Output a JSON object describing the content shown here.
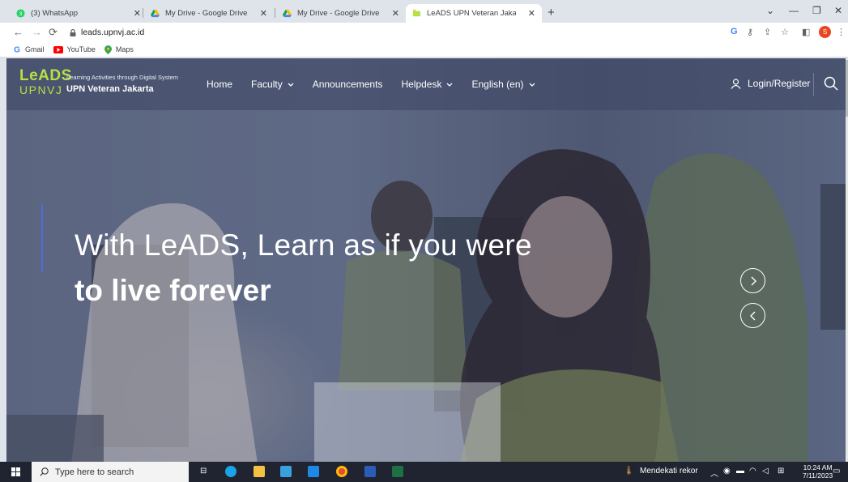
{
  "browser": {
    "tabs": [
      {
        "title": "(3) WhatsApp",
        "active": false
      },
      {
        "title": "My Drive - Google Drive",
        "active": false
      },
      {
        "title": "My Drive - Google Drive",
        "active": false
      },
      {
        "title": "LeADS UPN Veteran Jakarta",
        "active": true
      }
    ],
    "url": "leads.upnvj.ac.id",
    "whatsapp_badge": "3",
    "profile_initial": "S",
    "bookmarks": [
      {
        "label": "Gmail",
        "icon": "google-icon"
      },
      {
        "label": "YouTube",
        "icon": "youtube-icon"
      },
      {
        "label": "Maps",
        "icon": "maps-pin-icon"
      }
    ]
  },
  "site": {
    "logo_text": "LeADS",
    "logo_sub": "UPNVJ",
    "tagline": "Learning Activities through Digital System",
    "university": "UPN Veteran Jakarta",
    "menu": [
      {
        "label": "Home",
        "dropdown": false
      },
      {
        "label": "Faculty",
        "dropdown": true
      },
      {
        "label": "Announcements",
        "dropdown": false
      },
      {
        "label": "Helpdesk",
        "dropdown": true
      },
      {
        "label": "English (en)",
        "dropdown": true
      }
    ],
    "login_label": "Login/Register"
  },
  "hero": {
    "line1": "With LeADS, Learn as if you were",
    "line2": "to live forever"
  },
  "taskbar": {
    "search_placeholder": "Type here to search",
    "weather": "Mendekati rekor",
    "time": "10:24 AM",
    "date": "7/11/2023"
  },
  "colors": {
    "leads_green": "#b6e144",
    "accent_blue": "#4b6fd6",
    "profile_orange": "#e8461f"
  }
}
